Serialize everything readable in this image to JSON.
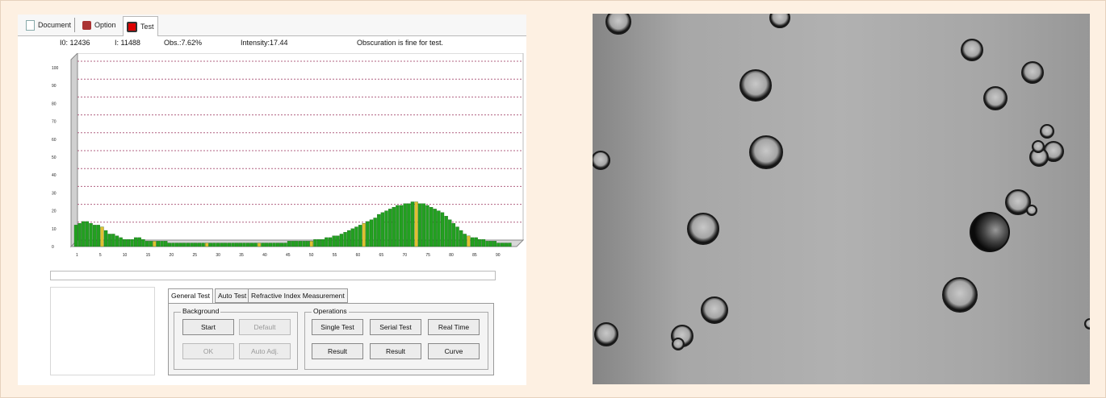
{
  "tabs": [
    {
      "label": "Document",
      "icon": "document-icon"
    },
    {
      "label": "Option",
      "icon": "option-icon"
    },
    {
      "label": "Test",
      "icon": "test-icon",
      "active": true
    }
  ],
  "status": {
    "i0": "I0:   12436",
    "i": "I:   11488",
    "obs": "Obs.:7.62%",
    "intensity": "Intensity:17.44",
    "message": "Obscuration is fine for test."
  },
  "chart_data": {
    "type": "bar",
    "y_ticks": [
      "0",
      "10",
      "20",
      "30",
      "40",
      "50",
      "60",
      "70",
      "80",
      "90",
      "100"
    ],
    "x_ticks": [
      "1",
      "5",
      "10",
      "15",
      "20",
      "25",
      "30",
      "35",
      "40",
      "45",
      "50",
      "55",
      "60",
      "65",
      "70",
      "75",
      "80",
      "85",
      "90"
    ],
    "ylim": [
      0,
      100
    ],
    "grid": true,
    "values": [
      12,
      13,
      14,
      14,
      13,
      12,
      12,
      11,
      9,
      7,
      7,
      6,
      5,
      4,
      4,
      4,
      5,
      5,
      4,
      3,
      3,
      3,
      3,
      3,
      3,
      2,
      2,
      2,
      2,
      2,
      2,
      2,
      2,
      2,
      2,
      2,
      2,
      2,
      2,
      2,
      2,
      2,
      2,
      2,
      2,
      2,
      2,
      2,
      2,
      2,
      2,
      2,
      2,
      2,
      2,
      2,
      2,
      3,
      3,
      3,
      3,
      3,
      3,
      3,
      4,
      4,
      4,
      5,
      5,
      6,
      6,
      7,
      8,
      9,
      10,
      11,
      12,
      13,
      14,
      15,
      16,
      18,
      19,
      20,
      21,
      22,
      23,
      23,
      24,
      24,
      25,
      25,
      24,
      24,
      23,
      22,
      21,
      20,
      19,
      17,
      15,
      13,
      11,
      9,
      7,
      6,
      5,
      5,
      4,
      4,
      3,
      3,
      3,
      2,
      2,
      2,
      2
    ]
  },
  "subtabs": [
    "General Test",
    "Auto Test",
    "Refractive Index Measurement"
  ],
  "background_group": {
    "title": "Background",
    "buttons": [
      "Start",
      "Default",
      "OK",
      "Auto Adj."
    ]
  },
  "operations_group": {
    "title": "Operations",
    "buttons": [
      "Single Test",
      "Serial Test",
      "Real Time",
      "Result",
      "Result",
      "Curve"
    ]
  },
  "colors": {
    "bar": "#22a020",
    "bar_highlight": "#e0c030",
    "grid": "#b06080",
    "background": "#fdf0e2"
  }
}
